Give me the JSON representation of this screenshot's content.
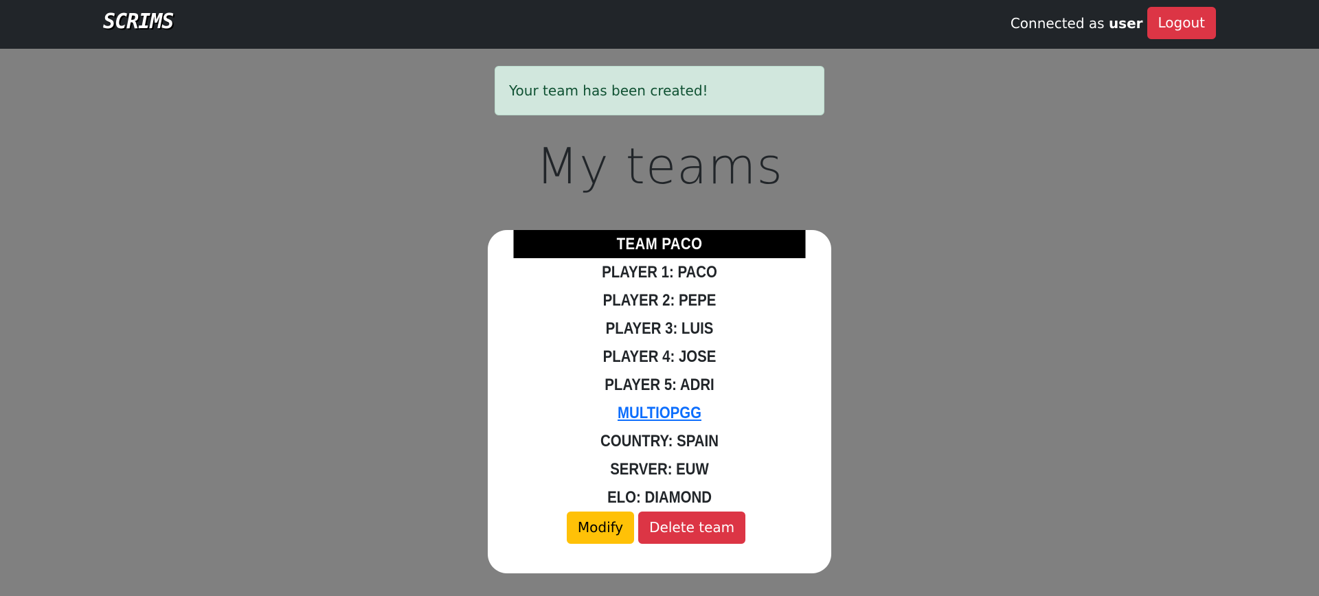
{
  "navbar": {
    "brand": "SCRIMS",
    "connected_prefix": "Connected as ",
    "username": "user",
    "logout_label": "Logout"
  },
  "alert": {
    "message": "Your team has been created!"
  },
  "page": {
    "title": "My teams"
  },
  "team": {
    "name": "Team Paco",
    "players": [
      "Player 1: Paco",
      "Player 2: Pepe",
      "Player 3: Luis",
      "Player 4: Jose",
      "Player 5: Adri"
    ],
    "link_label": "MultiOPGG",
    "country": "Country: Spain",
    "server": "Server: EUW",
    "elo": "Elo: Diamond",
    "modify_label": "Modify",
    "delete_label": "Delete team"
  },
  "colors": {
    "navbar_bg": "#212529",
    "page_bg": "#808080",
    "danger": "#dc3545",
    "warning": "#ffc107",
    "success_bg": "#d1e7dd",
    "link": "#0d6efd"
  }
}
